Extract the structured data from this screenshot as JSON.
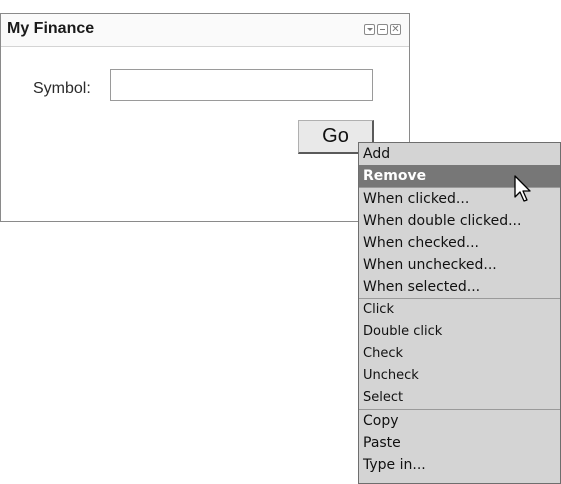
{
  "widget": {
    "title": "My Finance",
    "icons": [
      "menu-icon",
      "minimize-icon",
      "close-icon"
    ],
    "symbol_label": "Symbol:",
    "symbol_value": "",
    "go_label": "Go"
  },
  "context_menu": {
    "groups": [
      {
        "items": [
          "Add",
          "Remove"
        ],
        "selected": "Remove"
      },
      {
        "items": [
          "When clicked...",
          "When double clicked...",
          "When checked...",
          "When unchecked...",
          "When selected..."
        ]
      },
      {
        "items": [
          "Click",
          "Double click",
          "Check",
          "Uncheck",
          "Select"
        ]
      },
      {
        "items": [
          "Copy",
          "Paste",
          "Type in..."
        ]
      }
    ]
  },
  "colors": {
    "menu_bg": "#d4d4d4",
    "selected_bg": "#777777",
    "border": "#8a8a8a"
  }
}
